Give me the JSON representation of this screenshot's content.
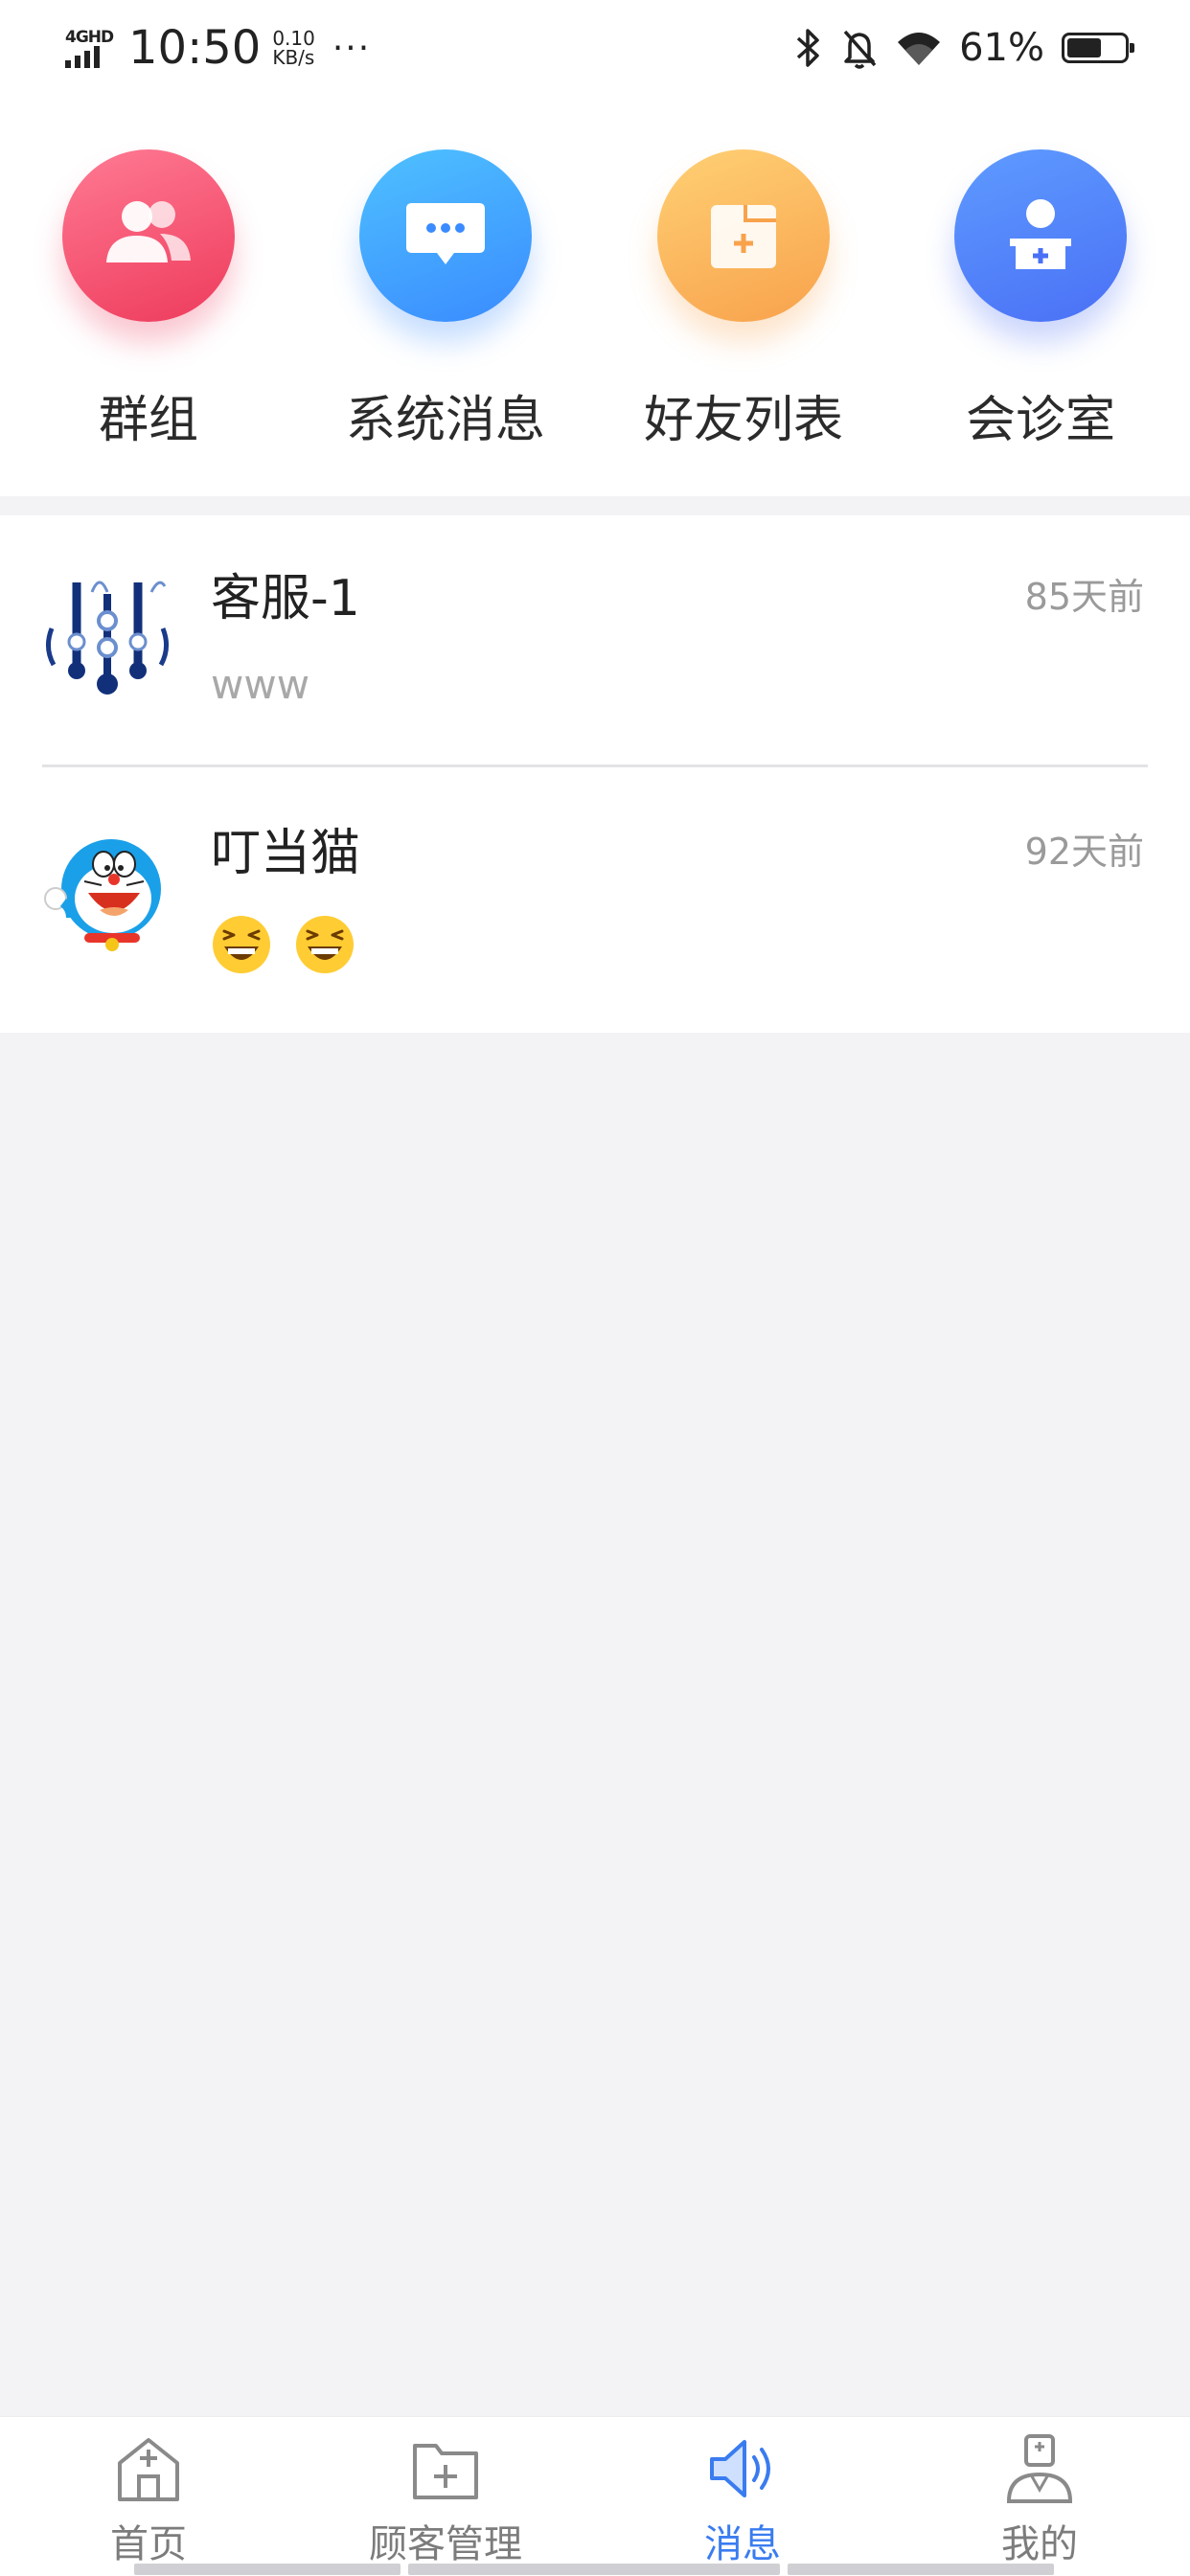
{
  "status_bar": {
    "network": "4GHD",
    "time": "10:50",
    "speed_value": "0.10",
    "speed_unit": "KB/s",
    "more": "···",
    "battery_percent": "61%",
    "battery_level": 0.61,
    "icons": [
      "bluetooth-icon",
      "mute-bell-icon",
      "wifi-icon",
      "battery-icon"
    ]
  },
  "quick_access": [
    {
      "label": "群组",
      "icon": "group-icon",
      "color": "#ee3b5c"
    },
    {
      "label": "系统消息",
      "icon": "message-bubble-icon",
      "color": "#3a8bff"
    },
    {
      "label": "好友列表",
      "icon": "contacts-folder-icon",
      "color": "#f8a24c"
    },
    {
      "label": "会诊室",
      "icon": "doctor-icon",
      "color": "#4a70f6"
    }
  ],
  "chats": [
    {
      "name": "客服-1",
      "time": "85天前",
      "preview": "www",
      "avatar": "company-logo-avatar"
    },
    {
      "name": "叮当猫",
      "time": "92天前",
      "preview": "😆😆",
      "avatar": "doraemon-avatar"
    }
  ],
  "tab_bar": {
    "active_color": "#3a7cf0",
    "inactive_color": "#7c7c7c",
    "tabs": [
      {
        "label": "首页",
        "icon": "home-icon",
        "active": false
      },
      {
        "label": "顾客管理",
        "icon": "customer-folder-icon",
        "active": false
      },
      {
        "label": "消息",
        "icon": "speaker-icon",
        "active": true
      },
      {
        "label": "我的",
        "icon": "profile-doctor-icon",
        "active": false
      }
    ]
  }
}
